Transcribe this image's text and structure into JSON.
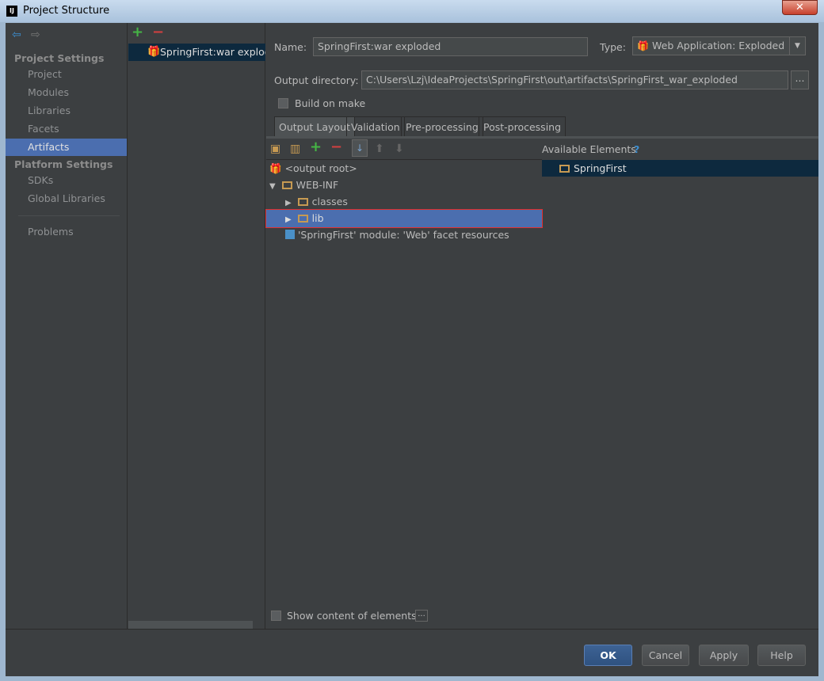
{
  "window": {
    "title": "Project Structure",
    "logo": "IJ",
    "close": "✕"
  },
  "sidebar": {
    "project_settings": "Project Settings",
    "items": [
      "Project",
      "Modules",
      "Libraries",
      "Facets",
      "Artifacts"
    ],
    "platform_settings": "Platform Settings",
    "platform_items": [
      "SDKs",
      "Global Libraries"
    ],
    "problems": "Problems",
    "selected": "Artifacts"
  },
  "artifacts": {
    "add": "+",
    "remove": "−",
    "items": [
      "SpringFirst:war exploded"
    ]
  },
  "form": {
    "name_label": "Name:",
    "name_value": "SpringFirst:war exploded",
    "type_label": "Type:",
    "type_value": "Web Application: Exploded",
    "output_dir_label": "Output directory:",
    "output_dir_value": "C:\\Users\\Lzj\\IdeaProjects\\SpringFirst\\out\\artifacts\\SpringFirst_war_exploded",
    "browse": "...",
    "build_on_make": "Build on make",
    "build_on_make_checked": false
  },
  "tabs": [
    "Output Layout",
    "Validation",
    "Pre-processing",
    "Post-processing"
  ],
  "active_tab": "Output Layout",
  "layout_tree": [
    {
      "label": "<output root>"
    },
    {
      "label": "WEB-INF",
      "expanded": true
    },
    {
      "label": "classes"
    },
    {
      "label": "lib",
      "selected": true
    },
    {
      "label": "'SpringFirst' module: 'Web' facet resources"
    }
  ],
  "available": {
    "title": "Available Elements",
    "help": "?",
    "items": [
      "SpringFirst"
    ]
  },
  "show_content": {
    "label": "Show content of elements",
    "checked": false,
    "more": "..."
  },
  "buttons": {
    "ok": "OK",
    "cancel": "Cancel",
    "apply": "Apply",
    "help": "Help"
  },
  "colors": {
    "background": "#3c3f41",
    "selection": "#4b6eaf",
    "inactive_selection": "#0d293e",
    "highlight_border": "#e03030"
  }
}
